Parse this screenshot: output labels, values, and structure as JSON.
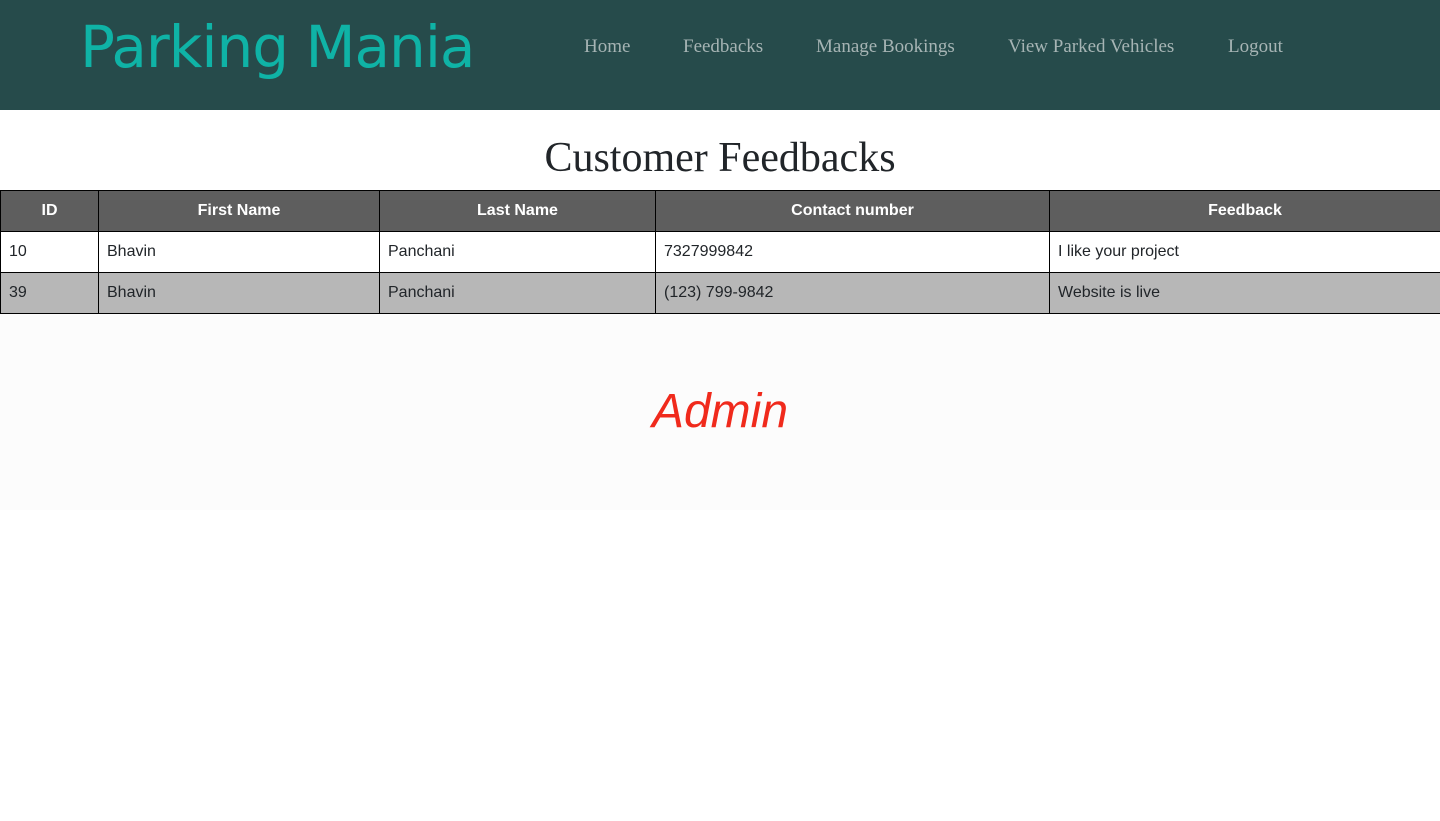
{
  "header": {
    "brand": "Parking Mania",
    "nav": {
      "home": "Home",
      "feedbacks": "Feedbacks",
      "manage_bookings": "Manage Bookings",
      "view_parked_vehicles": "View Parked Vehicles",
      "logout": "Logout"
    }
  },
  "main": {
    "title": "Customer Feedbacks",
    "table": {
      "columns": [
        "ID",
        "First Name",
        "Last Name",
        "Contact number",
        "Feedback"
      ],
      "rows": [
        [
          "10",
          "Bhavin",
          "Panchani",
          "7327999842",
          "I like your project"
        ],
        [
          "39",
          "Bhavin",
          "Panchani",
          "(123) 799-9842",
          "Website is live"
        ]
      ]
    }
  },
  "footer": {
    "role": "Admin"
  },
  "colors": {
    "navbar_bg": "#264b4b",
    "brand": "#0fb3a6",
    "nav_link": "#a6b4b4",
    "table_header_bg": "#5e5e5e",
    "row_alt_bg": "#b7b7b7",
    "footer_text": "#f02a1c"
  }
}
